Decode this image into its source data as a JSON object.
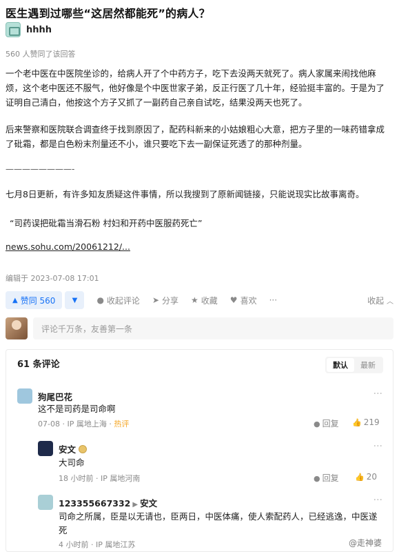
{
  "question": {
    "title": "医生遇到过哪些“这居然都能死”的病人？"
  },
  "author": {
    "name": "hhhh"
  },
  "answer": {
    "agree_text": "560 人赞同了该回答",
    "paragraph_1": "一个老中医在中医院坐诊的，给病人开了个中药方子，吃下去没两天就死了。病人家属来闹找他麻烦，这个老中医还不服气，他好像是个中医世家子弟，反正行医了几十年，经验挺丰富的。于是为了证明自己清白，他按这个方子又抓了一副药自己亲自试吃，结果没两天也死了。",
    "paragraph_2": "后来警察和医院联合调查终于找到原因了，配药科新来的小姑娘粗心大意，把方子里的一味药错拿成了砒霜，都是白色粉末剂量还不小，谁只要吃下去一副保证死透了的那种剂量。",
    "divider": "————————-",
    "paragraph_3": "七月8日更新，有许多知友质疑这件事情，所以我搜到了原新闻链接，只能说现实比故事离奇。",
    "quote": "“司药误把砒霜当滑石粉 村妇和开药中医服药死亡”",
    "link": "news.sohu.com/20061212/...",
    "edited": "编辑于 2023-07-08 17:01"
  },
  "actions": {
    "upvote": "赞同 560",
    "comment": "收起评论",
    "share": "分享",
    "favorite": "收藏",
    "like": "喜欢",
    "more": "···",
    "collapse": "收起"
  },
  "comment_box": {
    "placeholder": "评论千万条，友善第一条"
  },
  "comments": {
    "count": "61 条评论",
    "sort_default": "默认",
    "sort_latest": "最新",
    "items": [
      {
        "user": "狗尾巴花",
        "text": "这不是司药是司命啊",
        "meta": "07-08 · IP 属地上海 · ",
        "hot": "热评",
        "reply": "回复",
        "likes": "219"
      },
      {
        "user": "安文",
        "text": "大司命",
        "meta": "18 小时前 · IP 属地河南",
        "reply": "回复",
        "likes": "20"
      },
      {
        "user": "123355667332",
        "reply_to": "安文",
        "text": "司命之所属，臣是以无请也，臣两日，中医体痛，使人索配药人，已经逃逸，中医遂死",
        "meta": "4 小时前 · IP 属地江苏"
      }
    ]
  },
  "watermark": "@走神婆",
  "colors": {
    "accent": "#1772f6",
    "hot": "#f5a623",
    "muted": "#8a8a8a"
  }
}
